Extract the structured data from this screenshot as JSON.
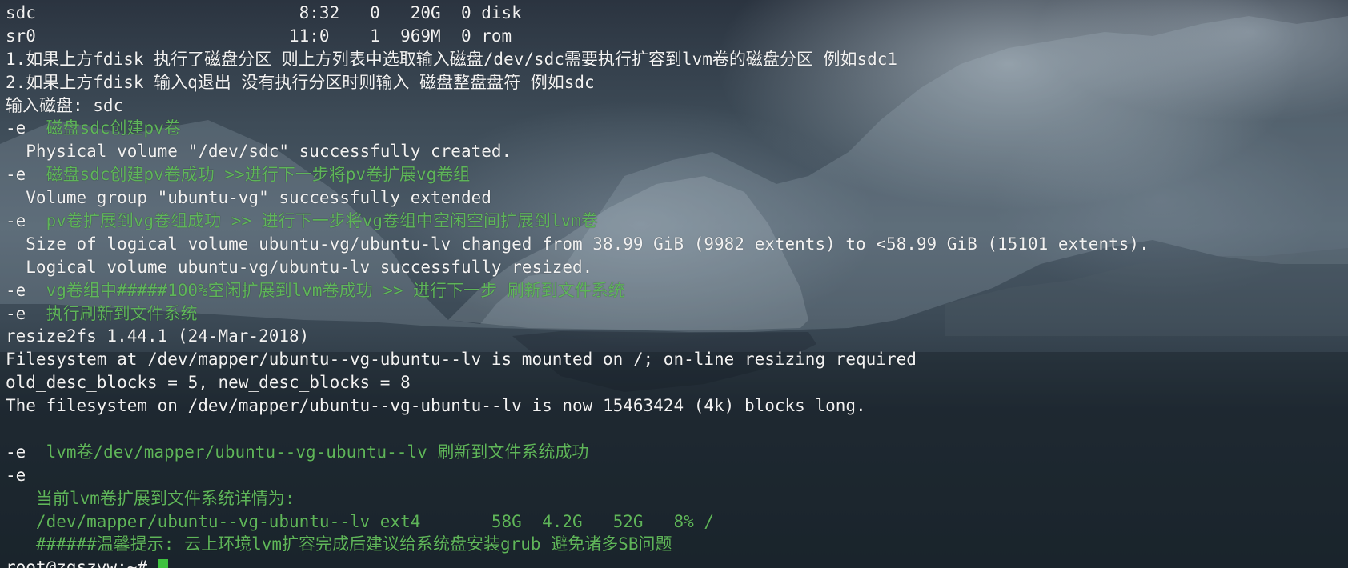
{
  "terminal": {
    "lines": [
      {
        "prefix": "",
        "text": "sdc                          8:32   0   20G  0 disk",
        "color": "white"
      },
      {
        "prefix": "",
        "text": "sr0                         11:0    1  969M  0 rom",
        "color": "white"
      },
      {
        "prefix": "",
        "text": "1.如果上方fdisk 执行了磁盘分区 则上方列表中选取输入磁盘/dev/sdc需要执行扩容到lvm卷的磁盘分区 例如sdc1",
        "color": "white"
      },
      {
        "prefix": "",
        "text": "2.如果上方fdisk 输入q退出 没有执行分区时则输入 磁盘整盘盘符 例如sdc",
        "color": "white"
      },
      {
        "prefix": "",
        "text": "输入磁盘: sdc",
        "color": "white"
      },
      {
        "prefix": "-e  ",
        "text": "磁盘sdc创建pv卷",
        "color": "green"
      },
      {
        "prefix": "",
        "text": "  Physical volume \"/dev/sdc\" successfully created.",
        "color": "white"
      },
      {
        "prefix": "-e  ",
        "text": "磁盘sdc创建pv卷成功 >>进行下一步将pv卷扩展vg卷组",
        "color": "green"
      },
      {
        "prefix": "",
        "text": "  Volume group \"ubuntu-vg\" successfully extended",
        "color": "white"
      },
      {
        "prefix": "-e  ",
        "text": "pv卷扩展到vg卷组成功 >> 进行下一步将vg卷组中空闲空间扩展到lvm卷",
        "color": "green"
      },
      {
        "prefix": "",
        "text": "  Size of logical volume ubuntu-vg/ubuntu-lv changed from 38.99 GiB (9982 extents) to <58.99 GiB (15101 extents).",
        "color": "white"
      },
      {
        "prefix": "",
        "text": "  Logical volume ubuntu-vg/ubuntu-lv successfully resized.",
        "color": "white"
      },
      {
        "prefix": "-e  ",
        "text": "vg卷组中#####100%空闲扩展到lvm卷成功 >> 进行下一步 刷新到文件系统",
        "color": "green"
      },
      {
        "prefix": "-e  ",
        "text": "执行刷新到文件系统",
        "color": "green"
      },
      {
        "prefix": "",
        "text": "resize2fs 1.44.1 (24-Mar-2018)",
        "color": "white"
      },
      {
        "prefix": "",
        "text": "Filesystem at /dev/mapper/ubuntu--vg-ubuntu--lv is mounted on /; on-line resizing required",
        "color": "white"
      },
      {
        "prefix": "",
        "text": "old_desc_blocks = 5, new_desc_blocks = 8",
        "color": "white"
      },
      {
        "prefix": "",
        "text": "The filesystem on /dev/mapper/ubuntu--vg-ubuntu--lv is now 15463424 (4k) blocks long.",
        "color": "white"
      },
      {
        "prefix": "",
        "text": "",
        "color": "white"
      },
      {
        "prefix": "-e  ",
        "text": "lvm卷/dev/mapper/ubuntu--vg-ubuntu--lv 刷新到文件系统成功",
        "color": "green"
      },
      {
        "prefix": "",
        "text": "-e",
        "color": "white"
      },
      {
        "prefix": "",
        "text": "   当前lvm卷扩展到文件系统详情为:",
        "color": "green"
      },
      {
        "prefix": "",
        "text": "   /dev/mapper/ubuntu--vg-ubuntu--lv ext4       58G  4.2G   52G   8% /",
        "color": "green"
      },
      {
        "prefix": "",
        "text": "   ######温馨提示: 云上环境lvm扩容完成后建议给系统盘安装grub 避免诸多SB问题",
        "color": "green"
      }
    ],
    "prompt": "root@zgszvw:~# ",
    "colors": {
      "text": "#f2f2f2",
      "highlight": "#5fb55a",
      "cursor": "#3fc23f"
    }
  }
}
